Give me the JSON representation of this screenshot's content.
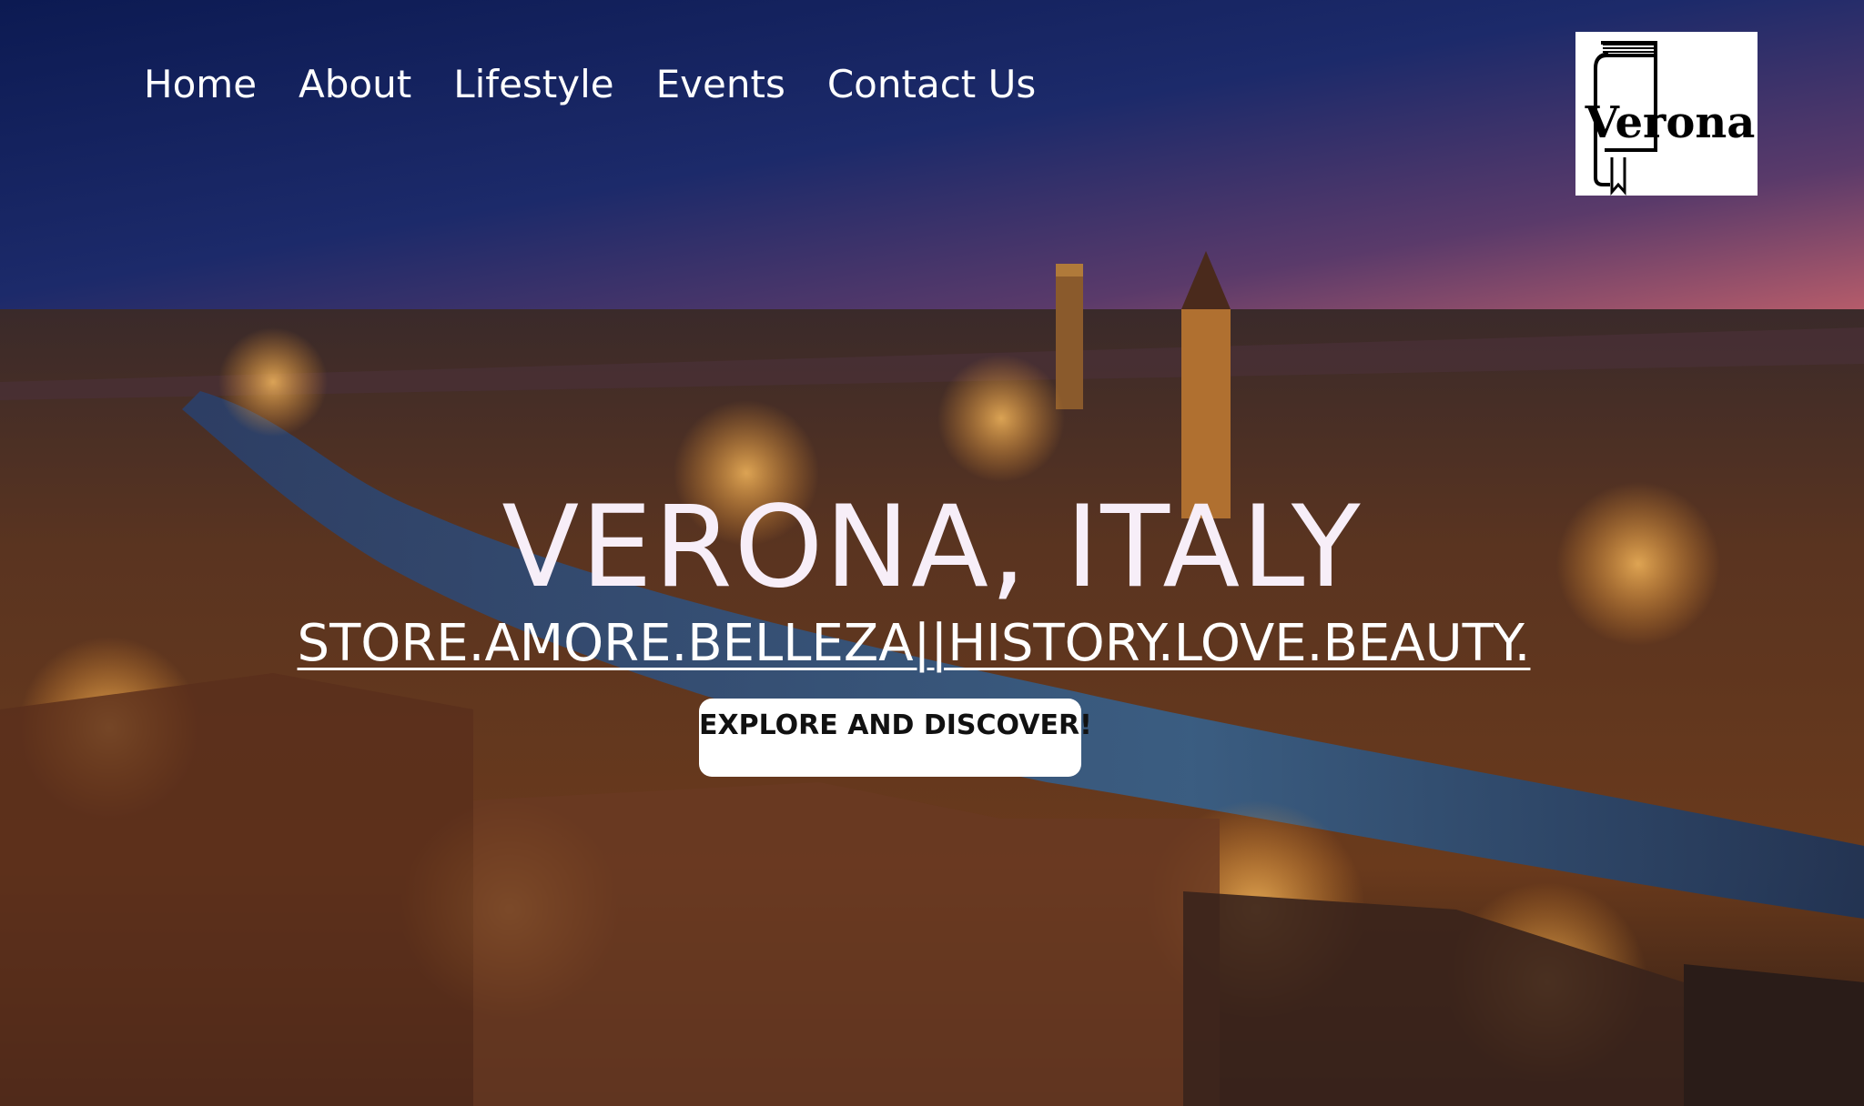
{
  "nav": {
    "items": [
      {
        "label": "Home"
      },
      {
        "label": "About"
      },
      {
        "label": "Lifestyle"
      },
      {
        "label": "Events"
      },
      {
        "label": "Contact Us"
      }
    ]
  },
  "logo": {
    "text": "Verona"
  },
  "hero": {
    "title": "VERONA, ITALY",
    "tagline": "STORE.AMORE.BELLEZA||HISTORY.LOVE.BEAUTY.",
    "cta_label": "EXPLORE AND DISCOVER!"
  },
  "colors": {
    "sky_top": "#0e1f5c",
    "sky_dusk": "#b0606e",
    "city_lights": "#f0a040",
    "river": "#2a4f7a",
    "title_text": "#f7eef8"
  }
}
